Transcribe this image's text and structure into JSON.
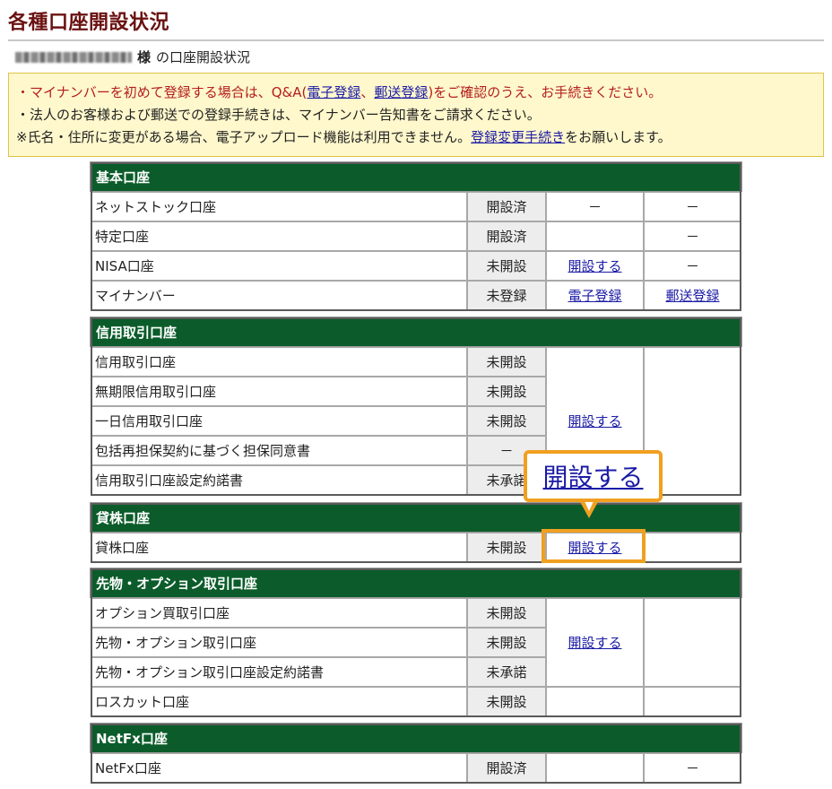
{
  "page": {
    "title": "各種口座開設状況",
    "owner_suffix": "様",
    "owner_label": "の口座開設状況"
  },
  "notice": {
    "line1_pre": "・マイナンバーを初めて登録する場合は、Q&A(",
    "line1_link1": "電子登録",
    "line1_sep": "、",
    "line1_link2": "郵送登録",
    "line1_post": ")をご確認のうえ、お手続きください。",
    "line2": "・法人のお客様および郵送での登録手続きは、マイナンバー告知書をご請求ください。",
    "line3_pre": "※氏名・住所に変更がある場合、電子アップロード機能は利用できません。",
    "line3_link": "登録変更手続き",
    "line3_post": "をお願いします。"
  },
  "sections": {
    "basic": {
      "title": "基本口座",
      "rows": [
        {
          "name": "ネットストック口座",
          "status": "開設済",
          "c3": "－",
          "c4": "－"
        },
        {
          "name": "特定口座",
          "status": "開設済",
          "c3": "",
          "c4": "－"
        },
        {
          "name": "NISA口座",
          "status": "未開設",
          "c3": "開設する",
          "c4": "－"
        },
        {
          "name": "マイナンバー",
          "status": "未登録",
          "c3": "電子登録",
          "c4": "郵送登録"
        }
      ]
    },
    "margin": {
      "title": "信用取引口座",
      "rows": [
        {
          "name": "信用取引口座",
          "status": "未開設"
        },
        {
          "name": "無期限信用取引口座",
          "status": "未開設"
        },
        {
          "name": "一日信用取引口座",
          "status": "未開設"
        },
        {
          "name": "包括再担保契約に基づく担保同意書",
          "status": "－"
        },
        {
          "name": "信用取引口座設定約諾書",
          "status": "未承諾"
        }
      ],
      "action": "開設する"
    },
    "lending": {
      "title": "貸株口座",
      "rows": [
        {
          "name": "貸株口座",
          "status": "未開設",
          "c3": "開設する"
        }
      ]
    },
    "futures": {
      "title": "先物・オプション取引口座",
      "rows": [
        {
          "name": "オプション買取引口座",
          "status": "未開設"
        },
        {
          "name": "先物・オプション取引口座",
          "status": "未開設"
        },
        {
          "name": "先物・オプション取引口座設定約諾書",
          "status": "未承諾"
        },
        {
          "name": "ロスカット口座",
          "status": "未開設"
        }
      ],
      "action": "開設する"
    },
    "netfx": {
      "title": "NetFx口座",
      "rows": [
        {
          "name": "NetFx口座",
          "status": "開設済",
          "c3": "",
          "c4": "－"
        }
      ]
    }
  },
  "callout": {
    "label": "開設する",
    "accent_color": "#f0a020"
  },
  "colors": {
    "section_header": "#0b5c2a",
    "title": "#6b1111",
    "link": "#1a1aa6",
    "notice_bg": "#fff8cc"
  }
}
